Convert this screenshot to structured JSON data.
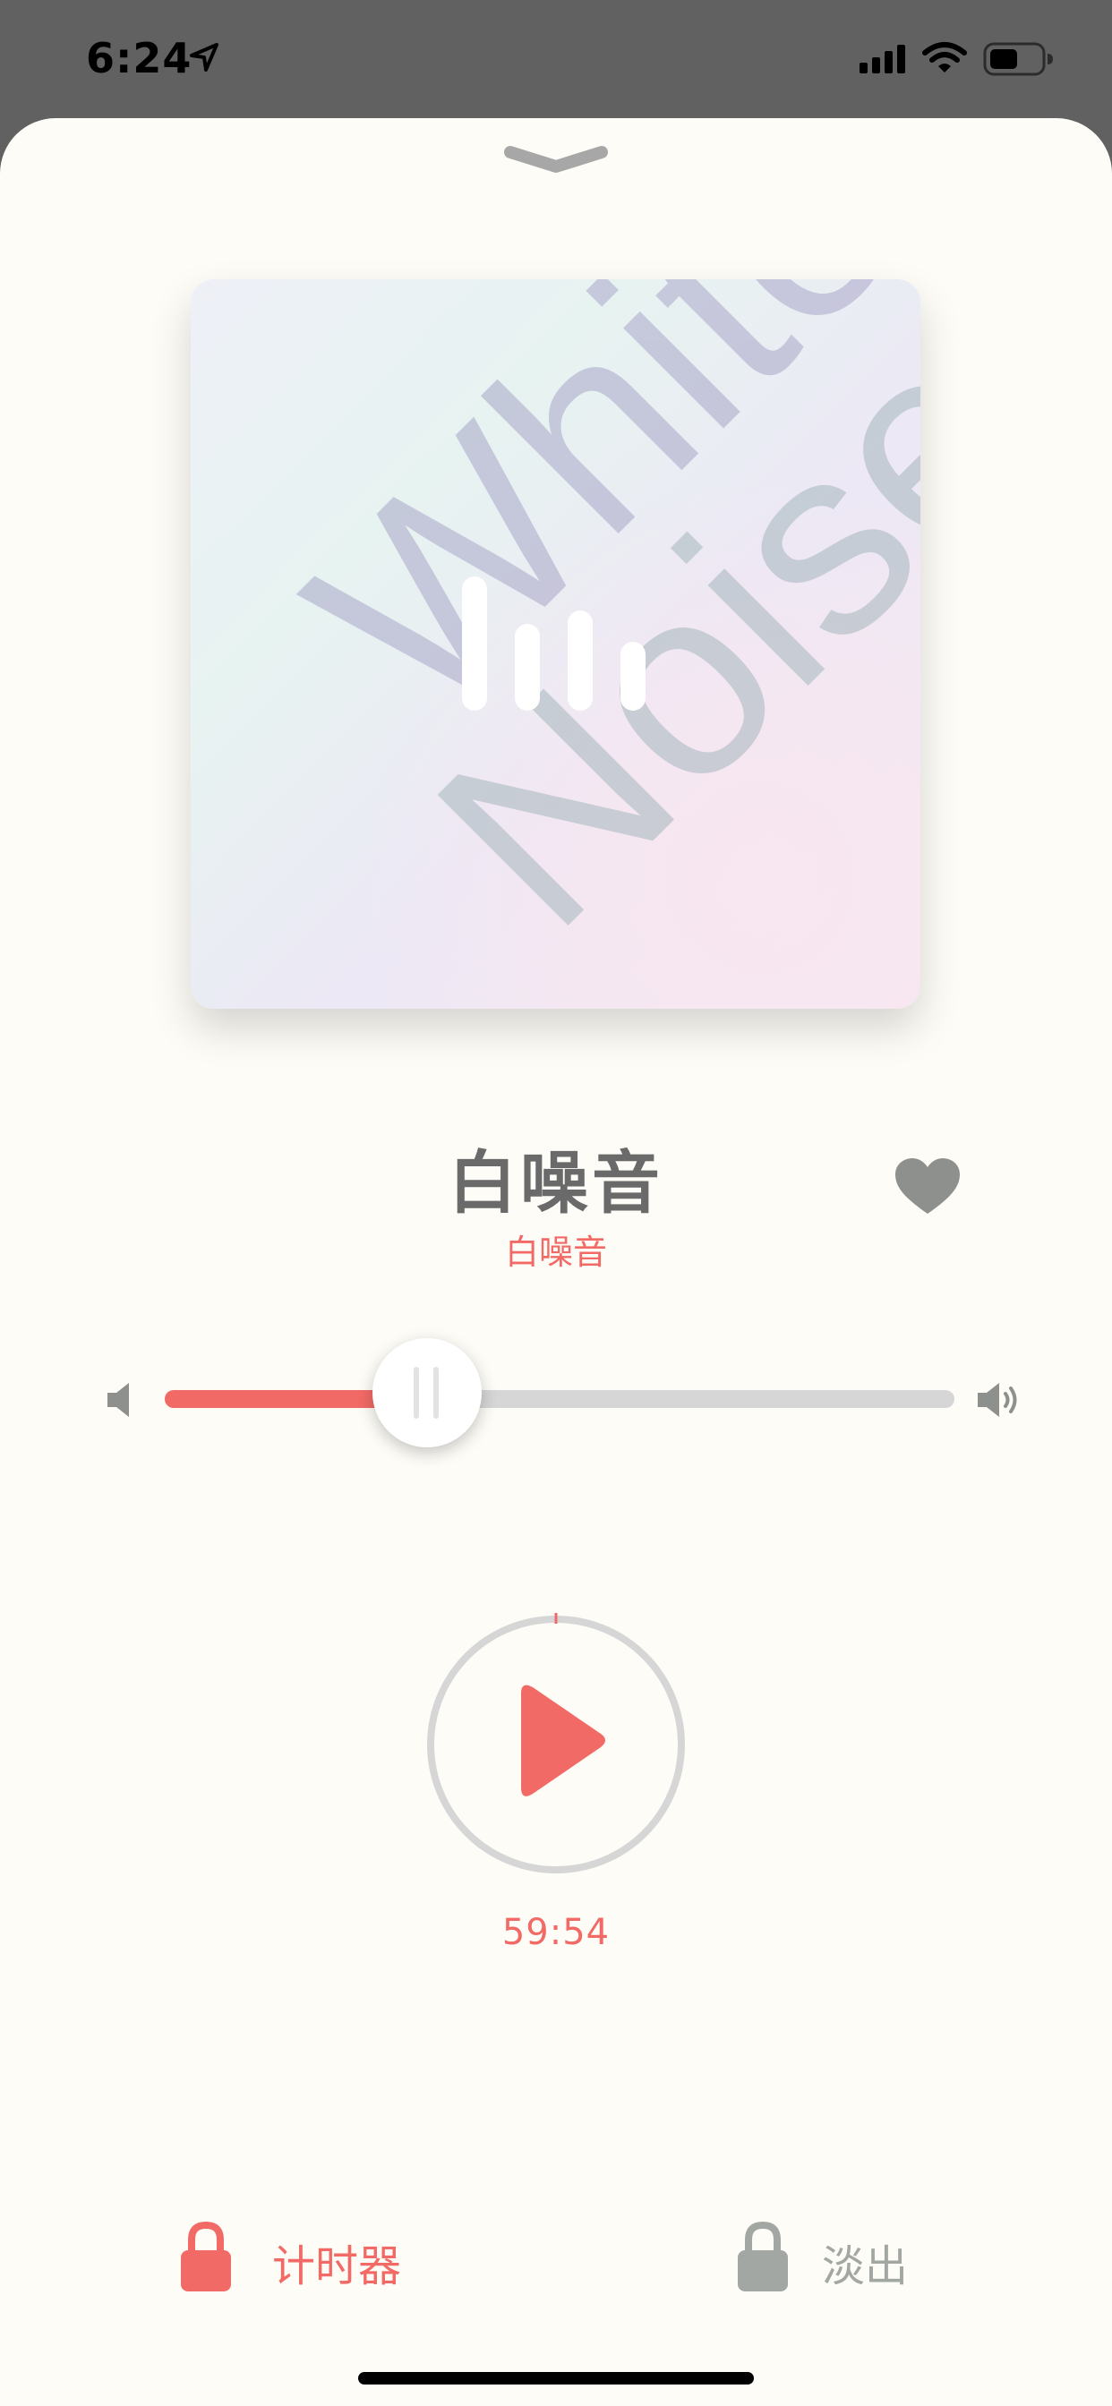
{
  "status_bar": {
    "time": "6:24",
    "icons": [
      "location-arrow-icon",
      "cellular-signal-icon",
      "wifi-icon",
      "battery-icon"
    ]
  },
  "sheet": {
    "collapse_icon": "chevron-down-icon"
  },
  "album": {
    "art_text_line1": "White",
    "art_text_line2": "Noise",
    "overlay_icon": "sound-bars-icon"
  },
  "track": {
    "title": "白噪音",
    "subtitle": "白噪音",
    "favorite_icon": "heart-icon"
  },
  "volume": {
    "level_percent": 33,
    "min_icon": "volume-low-icon",
    "max_icon": "volume-high-icon"
  },
  "player": {
    "play_icon": "play-icon",
    "timer": "59:54"
  },
  "bottom_controls": {
    "timer_label": "计时器",
    "fade_label": "淡出",
    "lock_icon": "lock-icon"
  },
  "colors": {
    "accent": "#f26a66",
    "sheet_background": "#fdfcf7",
    "muted": "#a3a7a3",
    "title": "#6a6a6a"
  }
}
